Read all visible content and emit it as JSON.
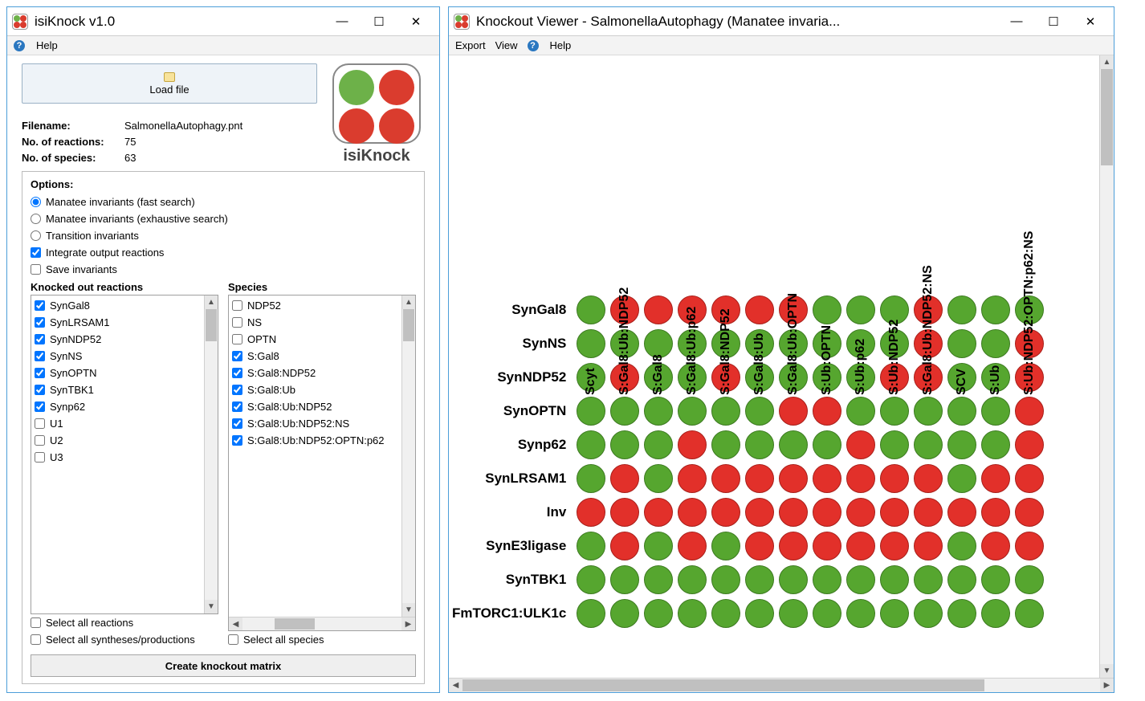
{
  "main": {
    "title": "isiKnock v1.0",
    "menu": {
      "help": "Help"
    },
    "load_button": "Load file",
    "meta": {
      "filename_label": "Filename:",
      "filename": "SalmonellaAutophagy.pnt",
      "reactions_label": "No. of reactions:",
      "reactions": "75",
      "species_label": "No. of species:",
      "species": "63"
    },
    "logo_text": "isiKnock",
    "options": {
      "header": "Options:",
      "radio_fast": "Manatee invariants (fast search)",
      "radio_exh": "Manatee invariants (exhaustive search)",
      "radio_trans": "Transition invariants",
      "chk_integrate": "Integrate output reactions",
      "chk_save": "Save invariants"
    },
    "reactions": {
      "header": "Knocked out reactions",
      "items": [
        {
          "label": "SynGal8",
          "checked": true
        },
        {
          "label": "SynLRSAM1",
          "checked": true
        },
        {
          "label": "SynNDP52",
          "checked": true
        },
        {
          "label": "SynNS",
          "checked": true
        },
        {
          "label": "SynOPTN",
          "checked": true
        },
        {
          "label": "SynTBK1",
          "checked": true
        },
        {
          "label": "Synp62",
          "checked": true
        },
        {
          "label": "U1",
          "checked": false
        },
        {
          "label": "U2",
          "checked": false
        },
        {
          "label": "U3",
          "checked": false
        }
      ]
    },
    "species_list": {
      "header": "Species",
      "items": [
        {
          "label": "NDP52",
          "checked": false
        },
        {
          "label": "NS",
          "checked": false
        },
        {
          "label": "OPTN",
          "checked": false
        },
        {
          "label": "S:Gal8",
          "checked": true
        },
        {
          "label": "S:Gal8:NDP52",
          "checked": true
        },
        {
          "label": "S:Gal8:Ub",
          "checked": true
        },
        {
          "label": "S:Gal8:Ub:NDP52",
          "checked": true
        },
        {
          "label": "S:Gal8:Ub:NDP52:NS",
          "checked": true
        },
        {
          "label": "S:Gal8:Ub:NDP52:OPTN:p62",
          "checked": true
        }
      ]
    },
    "footer": {
      "sel_reactions": "Select all reactions",
      "sel_species": "Select all species",
      "sel_synth": "Select all syntheses/productions"
    },
    "create_btn": "Create knockout matrix"
  },
  "viewer": {
    "title": "Knockout Viewer - SalmonellaAutophagy (Manatee invaria...",
    "menu": {
      "export": "Export",
      "view": "View",
      "help": "Help"
    },
    "columns": [
      "Scyt",
      "S:Gal8:Ub:NDP52",
      "S:Gal8",
      "S:Gal8:Ub:p62",
      "S:Gal8:NDP52",
      "S:Gal8:Ub",
      "S:Gal8:Ub:OPTN",
      "S:Ub:OPTN",
      "S:Ub:p62",
      "S:Ub:NDP52",
      "S:Gal8:Ub:NDP52:NS",
      "SCV",
      "S:Ub",
      "S:Ub:NDP52:OPTN:p62:NS"
    ],
    "rows": [
      "SynGal8",
      "SynNS",
      "SynNDP52",
      "SynOPTN",
      "Synp62",
      "SynLRSAM1",
      "Inv",
      "SynE3ligase",
      "SynTBK1",
      "FmTORC1:ULK1c"
    ],
    "matrix": [
      [
        0,
        1,
        1,
        1,
        1,
        1,
        1,
        0,
        0,
        0,
        1,
        0,
        0,
        0
      ],
      [
        0,
        0,
        0,
        0,
        0,
        0,
        0,
        0,
        0,
        0,
        1,
        0,
        0,
        1
      ],
      [
        0,
        1,
        0,
        0,
        1,
        0,
        0,
        0,
        0,
        1,
        1,
        0,
        0,
        1
      ],
      [
        0,
        0,
        0,
        0,
        0,
        0,
        1,
        1,
        0,
        0,
        0,
        0,
        0,
        1
      ],
      [
        0,
        0,
        0,
        1,
        0,
        0,
        0,
        0,
        1,
        0,
        0,
        0,
        0,
        1
      ],
      [
        0,
        1,
        0,
        1,
        1,
        1,
        1,
        1,
        1,
        1,
        1,
        0,
        1,
        1
      ],
      [
        1,
        1,
        1,
        1,
        1,
        1,
        1,
        1,
        1,
        1,
        1,
        1,
        1,
        1
      ],
      [
        0,
        1,
        0,
        1,
        0,
        1,
        1,
        1,
        1,
        1,
        1,
        0,
        1,
        1
      ],
      [
        0,
        0,
        0,
        0,
        0,
        0,
        0,
        0,
        0,
        0,
        0,
        0,
        0,
        0
      ],
      [
        0,
        0,
        0,
        0,
        0,
        0,
        0,
        0,
        0,
        0,
        0,
        0,
        0,
        0
      ]
    ]
  },
  "win_ctrl": {
    "min": "—",
    "max": "☐",
    "close": "✕"
  }
}
